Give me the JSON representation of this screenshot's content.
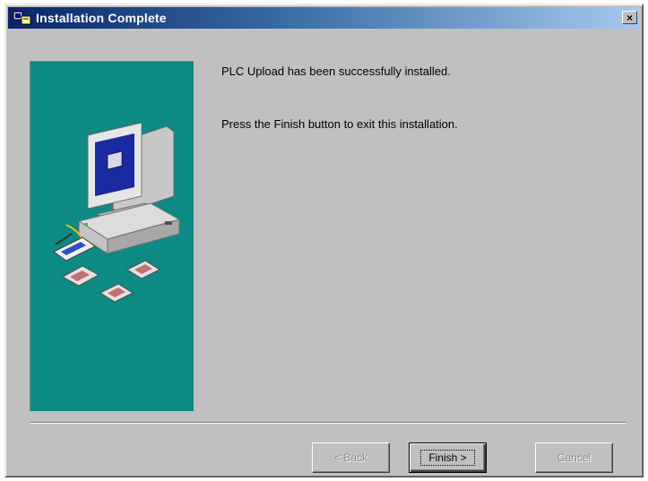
{
  "window": {
    "title": "Installation Complete",
    "close_glyph": "×"
  },
  "messages": {
    "line1": "PLC Upload has been successfully installed.",
    "line2": "Press the Finish button to exit this installation."
  },
  "buttons": {
    "back": "< Back",
    "finish": "Finish >",
    "cancel": "Cancel"
  },
  "colors": {
    "side_panel": "#0d8a84",
    "dialog_face": "#c0c0c0",
    "titlebar_start": "#0a246a"
  },
  "icons": {
    "title": "installer-icon",
    "illustration": "computer-with-disks"
  }
}
